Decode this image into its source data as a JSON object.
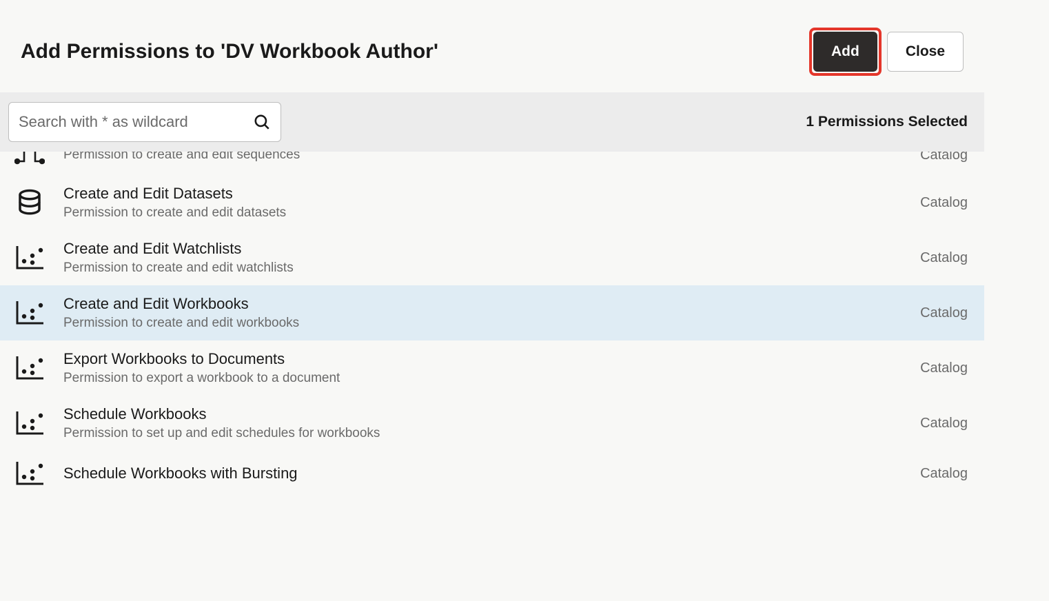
{
  "header": {
    "title": "Add Permissions to 'DV Workbook Author'",
    "add_label": "Add",
    "close_label": "Close"
  },
  "search": {
    "placeholder": "Search with * as wildcard",
    "selected_text": "1 Permissions Selected"
  },
  "permissions": [
    {
      "icon": "sequence",
      "title": "",
      "description": "Permission to create and edit sequences",
      "category": "Catalog",
      "selected": false,
      "partial": true
    },
    {
      "icon": "database",
      "title": "Create and Edit Datasets",
      "description": "Permission to create and edit datasets",
      "category": "Catalog",
      "selected": false
    },
    {
      "icon": "chart",
      "title": "Create and Edit Watchlists",
      "description": "Permission to create and edit watchlists",
      "category": "Catalog",
      "selected": false
    },
    {
      "icon": "chart",
      "title": "Create and Edit Workbooks",
      "description": "Permission to create and edit workbooks",
      "category": "Catalog",
      "selected": true
    },
    {
      "icon": "chart",
      "title": "Export Workbooks to Documents",
      "description": "Permission to export a workbook to a document",
      "category": "Catalog",
      "selected": false
    },
    {
      "icon": "chart",
      "title": "Schedule Workbooks",
      "description": "Permission to set up and edit schedules for workbooks",
      "category": "Catalog",
      "selected": false
    },
    {
      "icon": "chart",
      "title": "Schedule Workbooks with Bursting",
      "description": "",
      "category": "Catalog",
      "selected": false,
      "partial_bottom": true
    }
  ]
}
